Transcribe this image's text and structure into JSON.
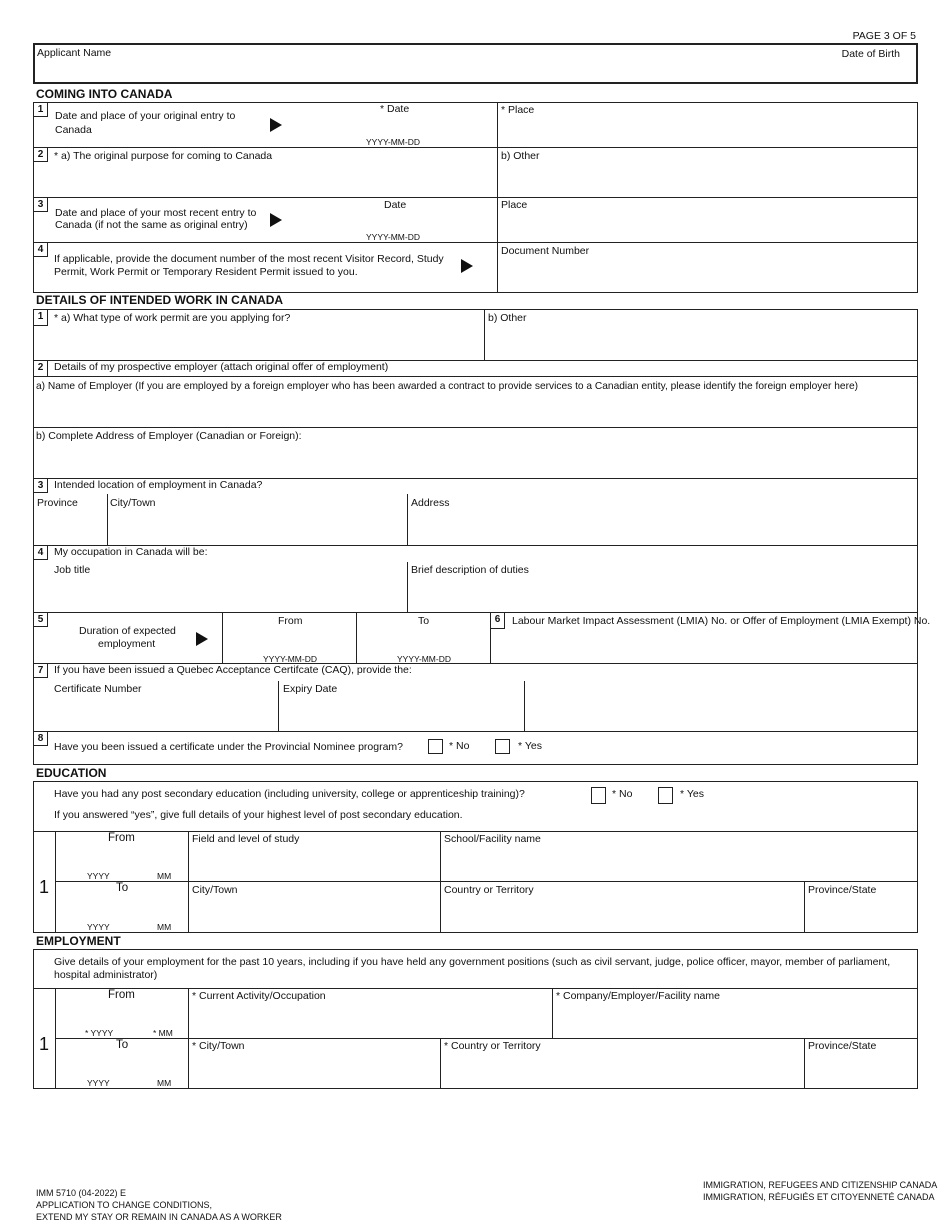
{
  "page_indicator": "PAGE 3 OF 5",
  "header": {
    "applicant_name_label": "Applicant Name",
    "date_of_birth_label": "Date of Birth"
  },
  "coming_into_canada": {
    "title": "COMING INTO CANADA",
    "q1": {
      "num": "1",
      "line1": "Date and place of your original entry to",
      "line2": "Canada",
      "date_label": "* Date",
      "date_format": "YYYY-MM-DD",
      "place_label": "* Place"
    },
    "q2": {
      "num": "2",
      "label": "* a) The original purpose for coming to Canada",
      "other_label": "b) Other"
    },
    "q3": {
      "num": "3",
      "line1": "Date and place of your most recent entry to",
      "line2": "Canada (if not the same as original entry)",
      "date_label": "Date",
      "date_format": "YYYY-MM-DD",
      "place_label": "Place"
    },
    "q4": {
      "num": "4",
      "line1": "If applicable, provide the document number of the most recent Visitor Record, Study",
      "line2": "Permit, Work Permit or Temporary Resident Permit issued to you.",
      "doc_label": "Document Number"
    }
  },
  "intended_work": {
    "title": "DETAILS OF INTENDED WORK IN CANADA",
    "q1": {
      "num": "1",
      "label": "* a) What type of work permit are you applying for?",
      "other_label": "b) Other"
    },
    "q2": {
      "num": "2",
      "label": "Details of my prospective employer (attach original offer of employment)",
      "a_label": "a) Name of Employer (If you are employed by a foreign employer who has been awarded a contract to provide services to a Canadian entity, please identify the foreign employer here)",
      "b_label": "b) Complete Address of Employer (Canadian or Foreign):"
    },
    "q3": {
      "num": "3",
      "label": "Intended location of employment in Canada?",
      "province_label": "Province",
      "city_label": "City/Town",
      "address_label": "Address"
    },
    "q4": {
      "num": "4",
      "label": "My occupation in Canada will be:",
      "job_title_label": "Job title",
      "duties_label": "Brief description of duties"
    },
    "q5": {
      "num": "5",
      "line1": "Duration of expected",
      "line2": "employment",
      "from_label": "From",
      "to_label": "To",
      "date_format": "YYYY-MM-DD"
    },
    "q6": {
      "num": "6",
      "label": "Labour Market Impact Assessment (LMIA) No. or Offer of Employment (LMIA Exempt) No."
    },
    "q7": {
      "num": "7",
      "label": "If you have been issued a Quebec Acceptance Certifcate (CAQ), provide the:",
      "cert_label": "Certificate Number",
      "expiry_label": "Expiry Date"
    },
    "q8": {
      "num": "8",
      "label": "Have you been issued a certificate under the Provincial Nominee program?",
      "no_label": "* No",
      "yes_label": "* Yes"
    }
  },
  "education": {
    "title": "EDUCATION",
    "question": "Have you had any post secondary education (including university, college or apprenticeship training)?",
    "no_label": "* No",
    "yes_label": "* Yes",
    "instruction": "If you answered “yes”, give full details of your highest level of post secondary education.",
    "row_num": "1",
    "from_label": "From",
    "to_label": "To",
    "yyyy": "YYYY",
    "mm": "MM",
    "field_label": "Field and level of study",
    "school_label": "School/Facility name",
    "city_label": "City/Town",
    "country_label": "Country or Territory",
    "province_label": "Province/State"
  },
  "employment": {
    "title": "EMPLOYMENT",
    "instruction_line1": "Give details of your employment for the past 10 years, including if you have held any government positions (such as civil servant, judge, police officer, mayor, member of parliament,",
    "instruction_line2": "hospital administrator)",
    "row_num": "1",
    "from_label": "From",
    "to_label": "To",
    "from_yyyy": "* YYYY",
    "from_mm": "* MM",
    "to_yyyy": "YYYY",
    "to_mm": "MM",
    "activity_label": "* Current Activity/Occupation",
    "company_label": "* Company/Employer/Facility name",
    "city_label": "* City/Town",
    "country_label": "* Country or Territory",
    "province_label": "Province/State"
  },
  "footer": {
    "form_code": "IMM 5710 (04-2022) E",
    "form_title_line1": "APPLICATION TO CHANGE CONDITIONS,",
    "form_title_line2": "EXTEND MY STAY OR REMAIN IN CANADA AS A WORKER",
    "dept_en": "IMMIGRATION, REFUGEES AND CITIZENSHIP CANADA",
    "dept_fr": "IMMIGRATION, RÉFUGIÉS ET CITOYENNETÉ CANADA"
  }
}
